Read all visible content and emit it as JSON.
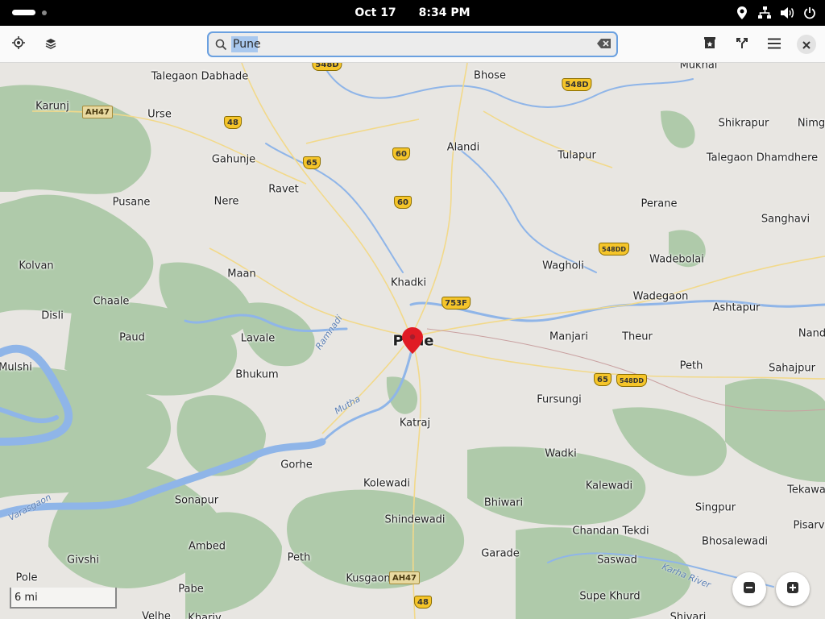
{
  "topbar": {
    "date": "Oct 17",
    "time": "8:34 PM",
    "icons": [
      "location-icon",
      "network-icon",
      "volume-icon",
      "power-icon"
    ]
  },
  "header": {
    "search_value": "Pune",
    "left_buttons": [
      "current-location-icon",
      "layers-icon"
    ],
    "right_buttons": [
      "favorites-icon",
      "route-icon",
      "menu-icon",
      "close-icon"
    ]
  },
  "map": {
    "places": [
      {
        "name": "Talegaon Dabhade"
      },
      {
        "name": "Bhose"
      },
      {
        "name": "Mukhai"
      },
      {
        "name": "Karunj"
      },
      {
        "name": "Urse"
      },
      {
        "name": "Shikrapur"
      },
      {
        "name": "Nimg"
      },
      {
        "name": "Alandi"
      },
      {
        "name": "Tulapur"
      },
      {
        "name": "Gahunje"
      },
      {
        "name": "Talegaon Dhamdhere"
      },
      {
        "name": "Ravet"
      },
      {
        "name": "Pusane"
      },
      {
        "name": "Nere"
      },
      {
        "name": "Perane"
      },
      {
        "name": "Sanghavi"
      },
      {
        "name": "Kolvan"
      },
      {
        "name": "Wagholi"
      },
      {
        "name": "Wadebolai"
      },
      {
        "name": "Maan"
      },
      {
        "name": "Khadki"
      },
      {
        "name": "Chaale"
      },
      {
        "name": "Wadegaon"
      },
      {
        "name": "Ashtapur"
      },
      {
        "name": "Disli"
      },
      {
        "name": "Paud"
      },
      {
        "name": "Lavale"
      },
      {
        "name": "Manjari"
      },
      {
        "name": "Theur"
      },
      {
        "name": "Nand"
      },
      {
        "name": "Pune"
      },
      {
        "name": "Mulshi"
      },
      {
        "name": "Peth"
      },
      {
        "name": "Sahajpur"
      },
      {
        "name": "Bhukum"
      },
      {
        "name": "Fursungi"
      },
      {
        "name": "Katraj"
      },
      {
        "name": "Wadki"
      },
      {
        "name": "Gorhe"
      },
      {
        "name": "Kolewadi"
      },
      {
        "name": "Kalewadi"
      },
      {
        "name": "Tekawa"
      },
      {
        "name": "Sonapur"
      },
      {
        "name": "Bhiwari"
      },
      {
        "name": "Singpur"
      },
      {
        "name": "Shindewadi"
      },
      {
        "name": "Pisarv"
      },
      {
        "name": "Chandan Tekdi"
      },
      {
        "name": "Ambed"
      },
      {
        "name": "Bhosalewadi"
      },
      {
        "name": "Garade"
      },
      {
        "name": "Givshi"
      },
      {
        "name": "Peth"
      },
      {
        "name": "Saswad"
      },
      {
        "name": "Pole"
      },
      {
        "name": "Kusgaon"
      },
      {
        "name": "Pabe"
      },
      {
        "name": "Supe Khurd"
      },
      {
        "name": "Velhe"
      },
      {
        "name": "Khariv"
      },
      {
        "name": "Shivari"
      }
    ],
    "rivers": [
      "Ramnadi",
      "Mutha",
      "Varasgaon",
      "Karha River"
    ],
    "shields": [
      {
        "label": "548D"
      },
      {
        "label": "548D"
      },
      {
        "label": "AH47"
      },
      {
        "label": "48"
      },
      {
        "label": "60"
      },
      {
        "label": "65"
      },
      {
        "label": "60"
      },
      {
        "label": "548DD"
      },
      {
        "label": "753F"
      },
      {
        "label": "65"
      },
      {
        "label": "548DD"
      },
      {
        "label": "AH47"
      },
      {
        "label": "48"
      }
    ],
    "scale_label": "6 mi",
    "zoom_out": "zoom-out-icon",
    "zoom_in": "zoom-in-icon",
    "colors": {
      "water": "#8fb5e8",
      "forest": "#a9c7a4",
      "land": "#e8e6e2",
      "road": "#f2d98a",
      "pin": "#e01b24"
    }
  }
}
